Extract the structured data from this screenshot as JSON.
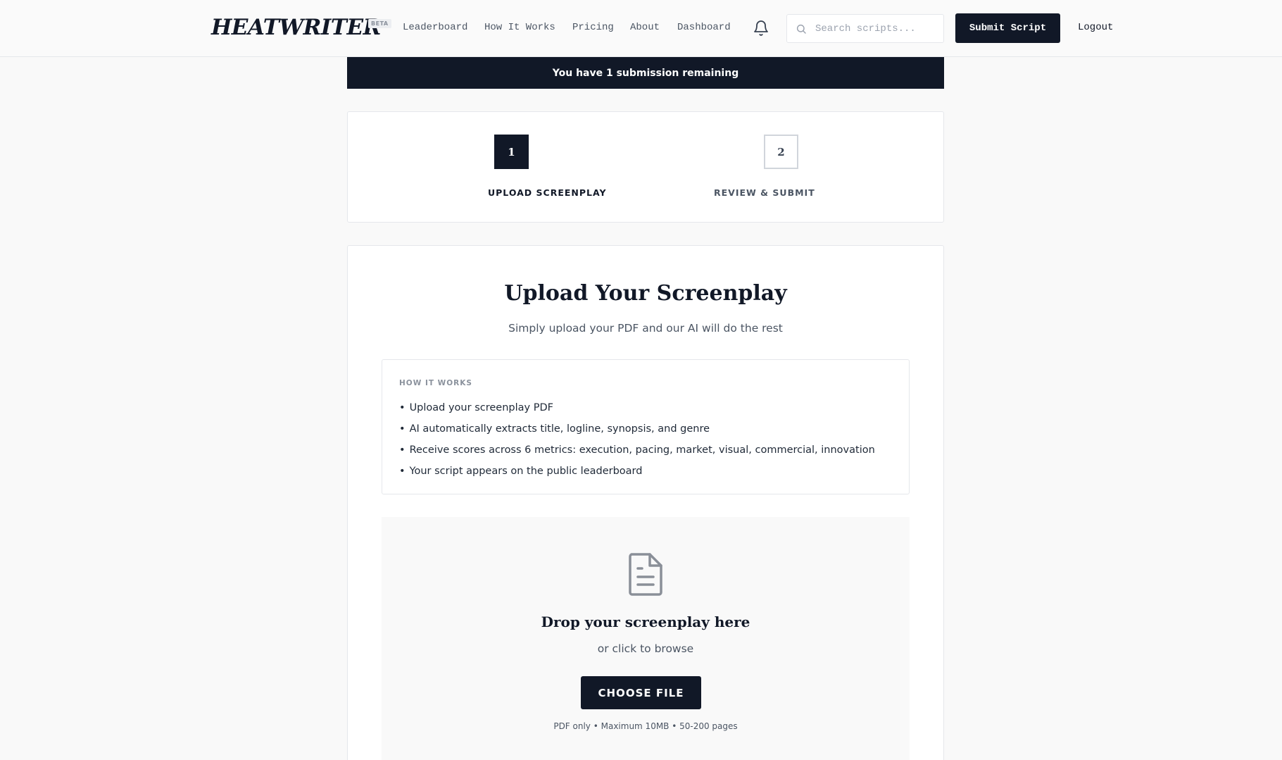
{
  "header": {
    "logo": "HEATWRITER",
    "badge": "BETA",
    "nav": [
      {
        "label": "Leaderboard"
      },
      {
        "label": "How It Works"
      },
      {
        "label": "Pricing"
      },
      {
        "label": "About"
      },
      {
        "label": "Dashboard"
      }
    ],
    "search_placeholder": "Search scripts...",
    "submit_label": "Submit Script",
    "logout_label": "Logout"
  },
  "banner": {
    "text": "You have 1 submission remaining"
  },
  "steps": [
    {
      "number": "1",
      "label": "UPLOAD SCREENPLAY",
      "state": "active"
    },
    {
      "number": "2",
      "label": "REVIEW & SUBMIT",
      "state": "inactive"
    }
  ],
  "main": {
    "title": "Upload Your Screenplay",
    "subtitle": "Simply upload your PDF and our AI will do the rest",
    "how_it_works": {
      "title": "HOW IT WORKS",
      "items": [
        "Upload your screenplay PDF",
        "AI automatically extracts title, logline, synopsis, and genre",
        "Receive scores across 6 metrics: execution, pacing, market, visual, commercial, innovation",
        "Your script appears on the public leaderboard"
      ]
    },
    "dropzone": {
      "title": "Drop your screenplay here",
      "subtitle": "or click to browse",
      "button_label": "CHOOSE FILE",
      "note": "PDF only • Maximum 10MB • 50-200 pages"
    }
  },
  "icons": {
    "bell": "bell-icon",
    "search": "search-icon",
    "document": "document-icon"
  },
  "colors": {
    "primary": "#111827",
    "background": "#f9f9f9",
    "border": "#e5e7eb",
    "muted_text": "#4b5563"
  }
}
